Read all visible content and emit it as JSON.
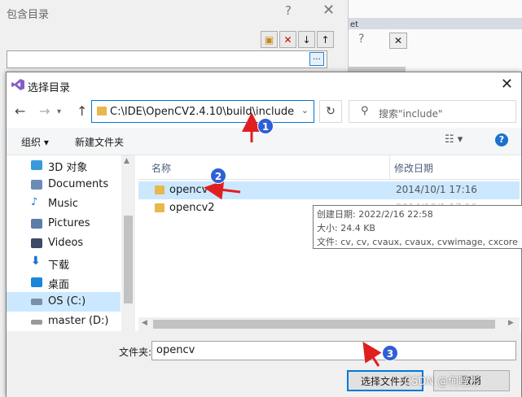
{
  "background_dialog": {
    "title": "包含目录",
    "help": "?",
    "close": "✕",
    "ellipsis": "..."
  },
  "background_right": {
    "strip_text": "et",
    "help": "?",
    "close": "✕"
  },
  "dialog": {
    "title": "选择目录",
    "close": "✕"
  },
  "nav": {
    "back": "←",
    "forward": "→",
    "up": "↑",
    "address": "C:\\IDE\\OpenCV2.4.10\\build\\include",
    "search_placeholder": "搜索\"include\""
  },
  "toolbar": {
    "organize": "组织 ▾",
    "new_folder": "新建文件夹",
    "help": "?"
  },
  "sidebar": {
    "items": [
      {
        "label": "3D 对象",
        "color": "#3a9ad9"
      },
      {
        "label": "Documents",
        "color": "#6a8db8"
      },
      {
        "label": "Music",
        "color": "#1a6fc9"
      },
      {
        "label": "Pictures",
        "color": "#5b7ea8"
      },
      {
        "label": "Videos",
        "color": "#3b4a66"
      },
      {
        "label": "下载",
        "color": "#1a73c9"
      },
      {
        "label": "桌面",
        "color": "#1a86d9"
      },
      {
        "label": "OS (C:)",
        "color": "#7a8ea6"
      },
      {
        "label": "master (D:)",
        "color": "#9a9a9a"
      }
    ]
  },
  "filelist": {
    "col_name": "名称",
    "col_date": "修改日期",
    "rows": [
      {
        "name": "opencv",
        "date": "2014/10/1 17:16"
      },
      {
        "name": "opencv2",
        "date": "2014/10/1 17:16"
      }
    ]
  },
  "tooltip": {
    "created": "创建日期: 2022/2/16 22:58",
    "size": "大小: 24.4 KB",
    "files": "文件: cv, cv, cvaux, cvaux, cvwimage, cxcore, c"
  },
  "bottom": {
    "folder_label": "文件夹:",
    "folder_value": "opencv",
    "ok": "选择文件夹",
    "cancel": "取消"
  },
  "annotations": {
    "b1": "1",
    "b2": "2",
    "b3": "3"
  },
  "watermark": "CSDN @何瞳彤"
}
